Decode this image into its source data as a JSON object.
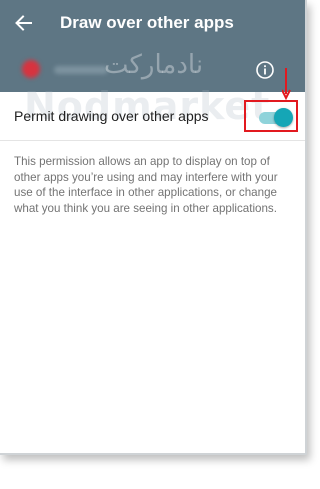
{
  "toolbar": {
    "title": "Draw over other apps",
    "back_icon": "arrow-left-icon"
  },
  "app_header": {
    "info_icon": "info-icon"
  },
  "watermark": {
    "persian": "نادمارکت",
    "latin": "Nodmarket"
  },
  "permission": {
    "label": "Permit drawing over other apps",
    "enabled": true,
    "description": "This permission allows an app to display on top of other apps you’re using and may interfere with your use of the interface in other applications, or change what you think you are seeing in other applications."
  },
  "colors": {
    "toolbar": "#5e7684",
    "switch_thumb": "#15a6b6",
    "switch_track": "#8fd3da",
    "highlight": "#e2191f"
  }
}
